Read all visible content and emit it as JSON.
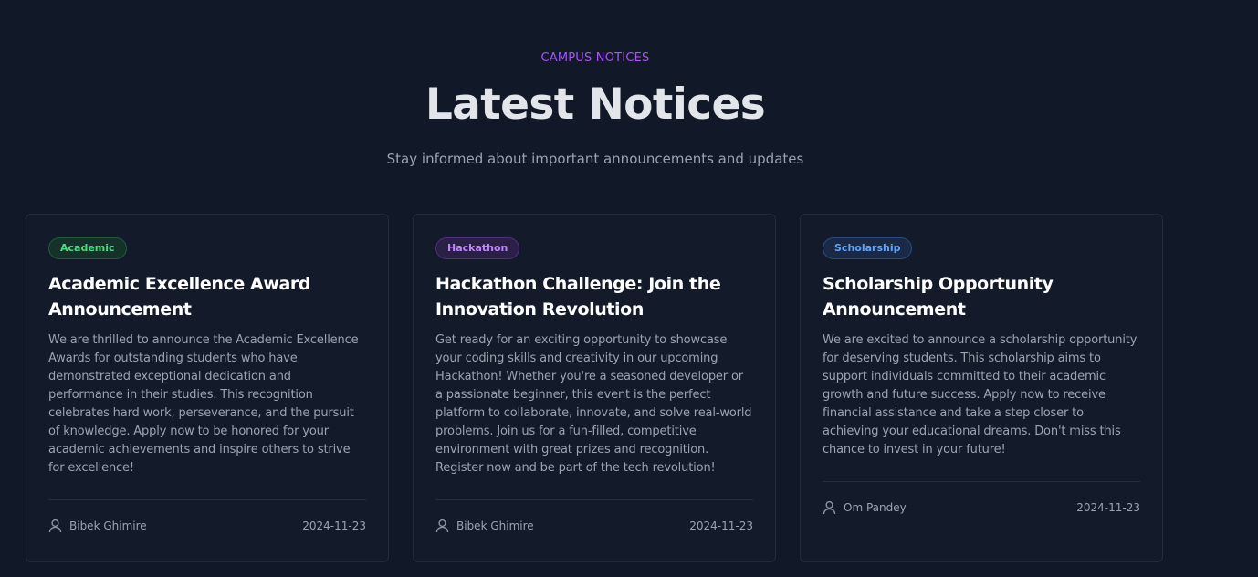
{
  "header": {
    "eyebrow": "CAMPUS NOTICES",
    "title": "Latest Notices",
    "subtitle": "Stay informed about important announcements and updates"
  },
  "notices": [
    {
      "category": "Academic",
      "category_color": "#4ade80",
      "title": "Academic Excellence Award Announcement",
      "body": "We are thrilled to announce the Academic Excellence Awards for outstanding students who have demonstrated exceptional dedication and performance in their studies. This recognition celebrates hard work, perseverance, and the pursuit of knowledge. Apply now to be honored for your academic achievements and inspire others to strive for excellence!",
      "author": "Bibek Ghimire",
      "date": "2024-11-23",
      "author_icon": "user-icon"
    },
    {
      "category": "Hackathon",
      "category_color": "#c084fc",
      "title": "Hackathon Challenge: Join the Innovation Revolution",
      "body": "Get ready for an exciting opportunity to showcase your coding skills and creativity in our upcoming Hackathon! Whether you're a seasoned developer or a passionate beginner, this event is the perfect platform to collaborate, innovate, and solve real-world problems. Join us for a fun-filled, competitive environment with great prizes and recognition. Register now and be part of the tech revolution!",
      "author": "Bibek Ghimire",
      "date": "2024-11-23",
      "author_icon": "user-icon"
    },
    {
      "category": "Scholarship",
      "category_color": "#60a5fa",
      "title": "Scholarship Opportunity Announcement",
      "body": "We are excited to announce a scholarship opportunity for deserving students. This scholarship aims to support individuals committed to their academic growth and future success. Apply now to receive financial assistance and take a step closer to achieving your educational dreams. Don't miss this chance to invest in your future!",
      "author": "Om Pandey",
      "date": "2024-11-23",
      "author_icon": "user-icon"
    }
  ],
  "colors": {
    "background": "#111827",
    "card": "#131b2b",
    "accent": "#a855f7"
  }
}
